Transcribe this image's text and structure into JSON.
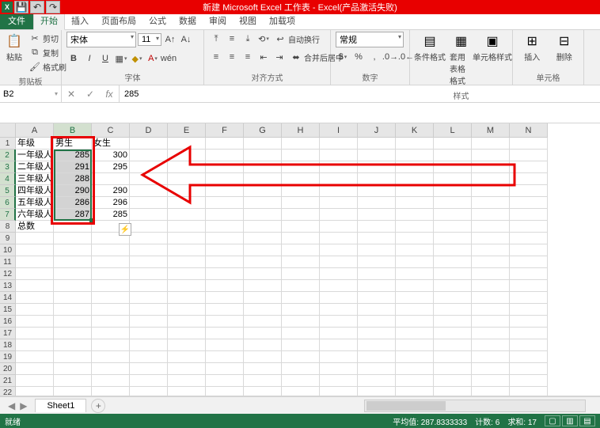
{
  "title": "新建 Microsoft Excel 工作表 - Excel(产品激活失败)",
  "tabs": {
    "file": "文件",
    "items": [
      "开始",
      "插入",
      "页面布局",
      "公式",
      "数据",
      "审阅",
      "视图",
      "加载项"
    ],
    "active": 0
  },
  "clipboard": {
    "paste": "粘贴",
    "cut": "剪切",
    "copy": "复制",
    "format_painter": "格式刷",
    "label": "剪贴板"
  },
  "font": {
    "name": "宋体",
    "size": "11",
    "label": "字体"
  },
  "alignment": {
    "wrap": "自动换行",
    "merge": "合并后居中",
    "label": "对齐方式"
  },
  "number": {
    "format": "常规",
    "label": "数字"
  },
  "styles": {
    "cond": "条件格式",
    "table": "套用\n表格格式",
    "cell": "单元格样式",
    "label": "样式"
  },
  "cells_grp": {
    "insert": "插入",
    "delete": "删除",
    "label": "单元格"
  },
  "name_box": "B2",
  "formula_value": "285",
  "columns": [
    "A",
    "B",
    "C",
    "D",
    "E",
    "F",
    "G",
    "H",
    "I",
    "J",
    "K",
    "L",
    "M",
    "N"
  ],
  "rows_shown": 23,
  "selected_col": 1,
  "selected_rows": [
    2,
    3,
    4,
    5,
    6,
    7
  ],
  "grid": {
    "r1": {
      "A": "年级",
      "B": "男生",
      "C": "女生"
    },
    "r2": {
      "A": "一年级人数",
      "B": "285",
      "C": "300"
    },
    "r3": {
      "A": "二年级人数",
      "B": "291",
      "C": "295"
    },
    "r4": {
      "A": "三年级人数",
      "B": "288",
      "C": ""
    },
    "r5": {
      "A": "四年级人数",
      "B": "290",
      "C": "290"
    },
    "r6": {
      "A": "五年级人数",
      "B": "286",
      "C": "296"
    },
    "r7": {
      "A": "六年级人数",
      "B": "287",
      "C": "285"
    },
    "r8": {
      "A": "总数"
    }
  },
  "sheet": {
    "name": "Sheet1"
  },
  "status": {
    "ready": "就绪",
    "avg_label": "平均值:",
    "avg": "287.8333333",
    "count_label": "计数:",
    "count": "6",
    "sum_label": "求和:",
    "sum": "17"
  },
  "chart_data": {
    "type": "table",
    "title": "",
    "columns": [
      "年级",
      "男生",
      "女生"
    ],
    "rows": [
      [
        "一年级人数",
        285,
        300
      ],
      [
        "二年级人数",
        291,
        295
      ],
      [
        "三年级人数",
        288,
        null
      ],
      [
        "四年级人数",
        290,
        290
      ],
      [
        "五年级人数",
        286,
        296
      ],
      [
        "六年级人数",
        287,
        285
      ],
      [
        "总数",
        null,
        null
      ]
    ]
  }
}
